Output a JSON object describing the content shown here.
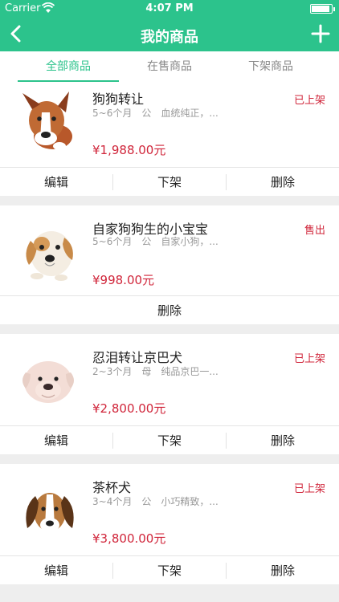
{
  "status_bar": {
    "carrier": "Carrier",
    "time": "4:07 PM"
  },
  "nav": {
    "title": "我的商品",
    "back_icon": "chevron-left-icon",
    "add_icon": "plus-icon"
  },
  "tabs": [
    {
      "label": "全部商品",
      "active": true
    },
    {
      "label": "在售商品",
      "active": false
    },
    {
      "label": "下架商品",
      "active": false
    }
  ],
  "items": [
    {
      "name": "狗狗转让",
      "desc": "5~6个月　公　血统纯正，...",
      "price": "¥1,988.00元",
      "status": "已上架",
      "actions": [
        "编辑",
        "下架",
        "删除"
      ]
    },
    {
      "name": "自家狗狗生的小宝宝",
      "desc": "5~6个月　公　自家小狗，...",
      "price": "¥998.00元",
      "status": "售出",
      "actions": [
        "删除"
      ]
    },
    {
      "name": "忍泪转让京巴犬",
      "desc": "2~3个月　母　纯品京巴一...",
      "price": "¥2,800.00元",
      "status": "已上架",
      "actions": [
        "编辑",
        "下架",
        "删除"
      ]
    },
    {
      "name": "茶杯犬",
      "desc": "3~4个月　公　小巧精致，...",
      "price": "¥3,800.00元",
      "status": "已上架",
      "actions": [
        "编辑",
        "下架",
        "删除"
      ]
    }
  ],
  "colors": {
    "accent": "#2cc38c",
    "price": "#d0253a"
  }
}
